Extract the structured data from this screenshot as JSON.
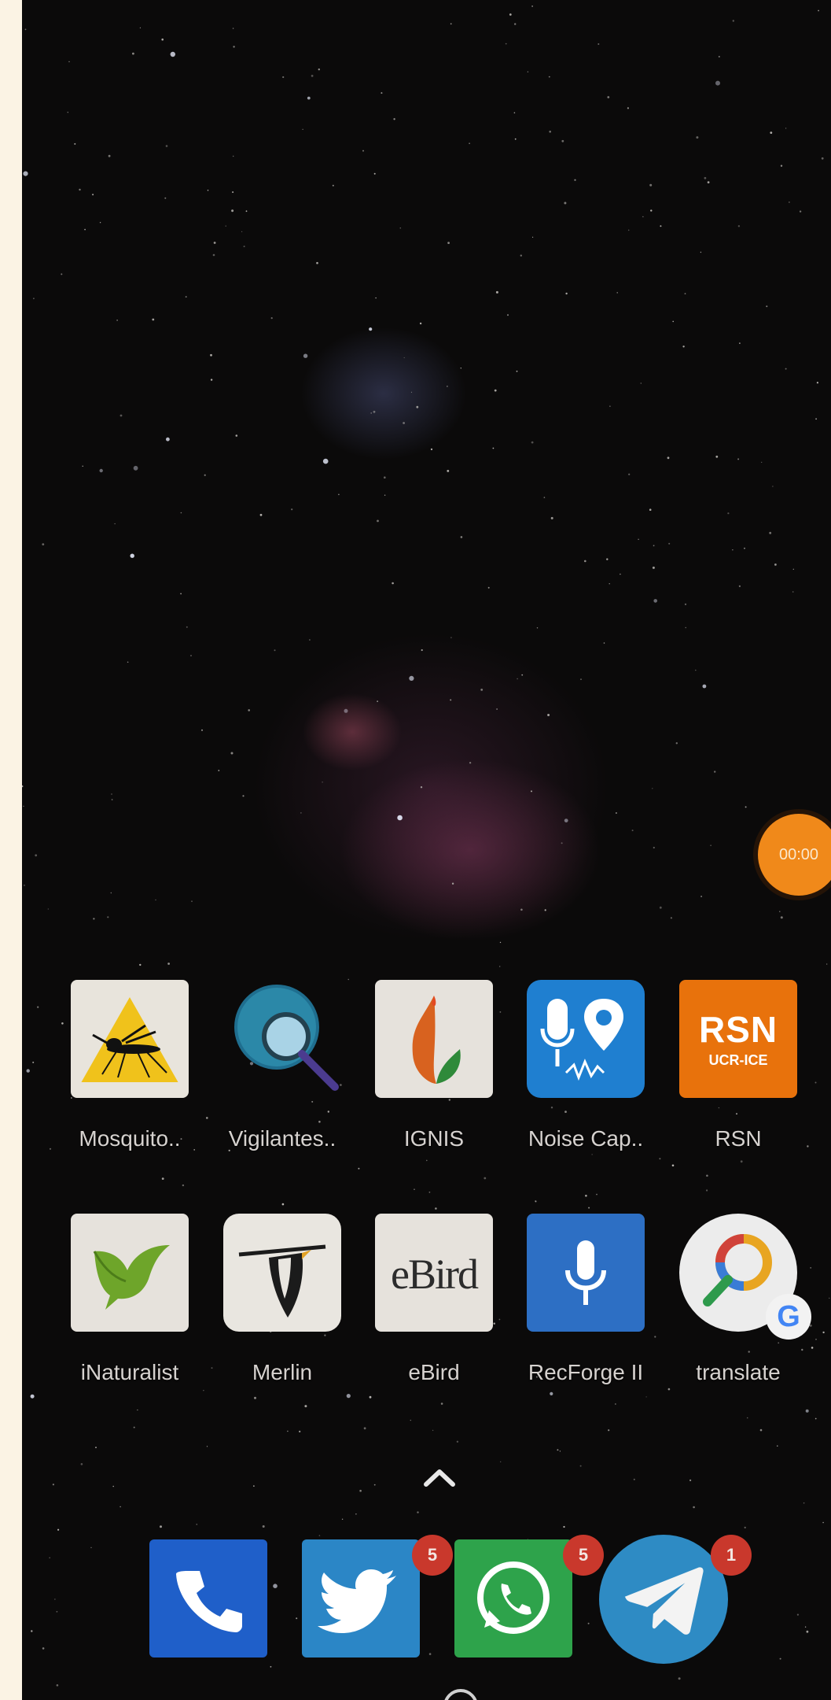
{
  "recorder": {
    "time": "00:00"
  },
  "apps_row1": [
    {
      "label": "Mosquito..",
      "icon": "mosquito-alert-icon"
    },
    {
      "label": "Vigilantes..",
      "icon": "magnifier-globe-icon"
    },
    {
      "label": "IGNIS",
      "icon": "flame-leaf-icon"
    },
    {
      "label": "Noise Cap..",
      "icon": "mic-location-icon"
    },
    {
      "label": "RSN",
      "icon": "rsn-logo-icon",
      "logo_main": "RSN",
      "logo_sub": "UCR-ICE"
    }
  ],
  "apps_row2": [
    {
      "label": "iNaturalist",
      "icon": "bird-leaf-icon"
    },
    {
      "label": "Merlin",
      "icon": "merlin-bird-icon"
    },
    {
      "label": "eBird",
      "icon": "ebird-logo-icon",
      "logo_text": "eBird"
    },
    {
      "label": "RecForge II",
      "icon": "microphone-icon"
    },
    {
      "label": "translate",
      "icon": "google-lens-search-icon",
      "badge_letter": "G"
    }
  ],
  "drawer": {
    "icon": "chevron-up-icon"
  },
  "dock": [
    {
      "name": "phone",
      "icon": "phone-icon",
      "badge": ""
    },
    {
      "name": "twitter",
      "icon": "twitter-bird-icon",
      "badge": "5"
    },
    {
      "name": "whatsapp",
      "icon": "whatsapp-icon",
      "badge": "5"
    },
    {
      "name": "telegram",
      "icon": "telegram-plane-icon",
      "badge": "1"
    }
  ],
  "colors": {
    "timer": "#f0891a",
    "badge": "#c9382c",
    "phone": "#1f5fc9",
    "twitter": "#2b86c6",
    "whatsapp": "#2ea34b",
    "telegram": "#2e8bc4",
    "rsn": "#e8720c"
  }
}
